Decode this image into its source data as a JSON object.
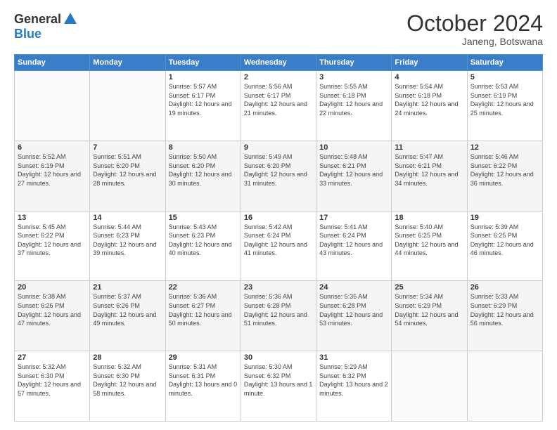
{
  "logo": {
    "general": "General",
    "blue": "Blue"
  },
  "title": "October 2024",
  "location": "Janeng, Botswana",
  "days_of_week": [
    "Sunday",
    "Monday",
    "Tuesday",
    "Wednesday",
    "Thursday",
    "Friday",
    "Saturday"
  ],
  "weeks": [
    [
      {
        "day": "",
        "info": ""
      },
      {
        "day": "",
        "info": ""
      },
      {
        "day": "1",
        "info": "Sunrise: 5:57 AM\nSunset: 6:17 PM\nDaylight: 12 hours and 19 minutes."
      },
      {
        "day": "2",
        "info": "Sunrise: 5:56 AM\nSunset: 6:17 PM\nDaylight: 12 hours and 21 minutes."
      },
      {
        "day": "3",
        "info": "Sunrise: 5:55 AM\nSunset: 6:18 PM\nDaylight: 12 hours and 22 minutes."
      },
      {
        "day": "4",
        "info": "Sunrise: 5:54 AM\nSunset: 6:18 PM\nDaylight: 12 hours and 24 minutes."
      },
      {
        "day": "5",
        "info": "Sunrise: 5:53 AM\nSunset: 6:19 PM\nDaylight: 12 hours and 25 minutes."
      }
    ],
    [
      {
        "day": "6",
        "info": "Sunrise: 5:52 AM\nSunset: 6:19 PM\nDaylight: 12 hours and 27 minutes."
      },
      {
        "day": "7",
        "info": "Sunrise: 5:51 AM\nSunset: 6:20 PM\nDaylight: 12 hours and 28 minutes."
      },
      {
        "day": "8",
        "info": "Sunrise: 5:50 AM\nSunset: 6:20 PM\nDaylight: 12 hours and 30 minutes."
      },
      {
        "day": "9",
        "info": "Sunrise: 5:49 AM\nSunset: 6:20 PM\nDaylight: 12 hours and 31 minutes."
      },
      {
        "day": "10",
        "info": "Sunrise: 5:48 AM\nSunset: 6:21 PM\nDaylight: 12 hours and 33 minutes."
      },
      {
        "day": "11",
        "info": "Sunrise: 5:47 AM\nSunset: 6:21 PM\nDaylight: 12 hours and 34 minutes."
      },
      {
        "day": "12",
        "info": "Sunrise: 5:46 AM\nSunset: 6:22 PM\nDaylight: 12 hours and 36 minutes."
      }
    ],
    [
      {
        "day": "13",
        "info": "Sunrise: 5:45 AM\nSunset: 6:22 PM\nDaylight: 12 hours and 37 minutes."
      },
      {
        "day": "14",
        "info": "Sunrise: 5:44 AM\nSunset: 6:23 PM\nDaylight: 12 hours and 39 minutes."
      },
      {
        "day": "15",
        "info": "Sunrise: 5:43 AM\nSunset: 6:23 PM\nDaylight: 12 hours and 40 minutes."
      },
      {
        "day": "16",
        "info": "Sunrise: 5:42 AM\nSunset: 6:24 PM\nDaylight: 12 hours and 41 minutes."
      },
      {
        "day": "17",
        "info": "Sunrise: 5:41 AM\nSunset: 6:24 PM\nDaylight: 12 hours and 43 minutes."
      },
      {
        "day": "18",
        "info": "Sunrise: 5:40 AM\nSunset: 6:25 PM\nDaylight: 12 hours and 44 minutes."
      },
      {
        "day": "19",
        "info": "Sunrise: 5:39 AM\nSunset: 6:25 PM\nDaylight: 12 hours and 46 minutes."
      }
    ],
    [
      {
        "day": "20",
        "info": "Sunrise: 5:38 AM\nSunset: 6:26 PM\nDaylight: 12 hours and 47 minutes."
      },
      {
        "day": "21",
        "info": "Sunrise: 5:37 AM\nSunset: 6:26 PM\nDaylight: 12 hours and 49 minutes."
      },
      {
        "day": "22",
        "info": "Sunrise: 5:36 AM\nSunset: 6:27 PM\nDaylight: 12 hours and 50 minutes."
      },
      {
        "day": "23",
        "info": "Sunrise: 5:36 AM\nSunset: 6:28 PM\nDaylight: 12 hours and 51 minutes."
      },
      {
        "day": "24",
        "info": "Sunrise: 5:35 AM\nSunset: 6:28 PM\nDaylight: 12 hours and 53 minutes."
      },
      {
        "day": "25",
        "info": "Sunrise: 5:34 AM\nSunset: 6:29 PM\nDaylight: 12 hours and 54 minutes."
      },
      {
        "day": "26",
        "info": "Sunrise: 5:33 AM\nSunset: 6:29 PM\nDaylight: 12 hours and 56 minutes."
      }
    ],
    [
      {
        "day": "27",
        "info": "Sunrise: 5:32 AM\nSunset: 6:30 PM\nDaylight: 12 hours and 57 minutes."
      },
      {
        "day": "28",
        "info": "Sunrise: 5:32 AM\nSunset: 6:30 PM\nDaylight: 12 hours and 58 minutes."
      },
      {
        "day": "29",
        "info": "Sunrise: 5:31 AM\nSunset: 6:31 PM\nDaylight: 13 hours and 0 minutes."
      },
      {
        "day": "30",
        "info": "Sunrise: 5:30 AM\nSunset: 6:32 PM\nDaylight: 13 hours and 1 minute."
      },
      {
        "day": "31",
        "info": "Sunrise: 5:29 AM\nSunset: 6:32 PM\nDaylight: 13 hours and 2 minutes."
      },
      {
        "day": "",
        "info": ""
      },
      {
        "day": "",
        "info": ""
      }
    ]
  ]
}
